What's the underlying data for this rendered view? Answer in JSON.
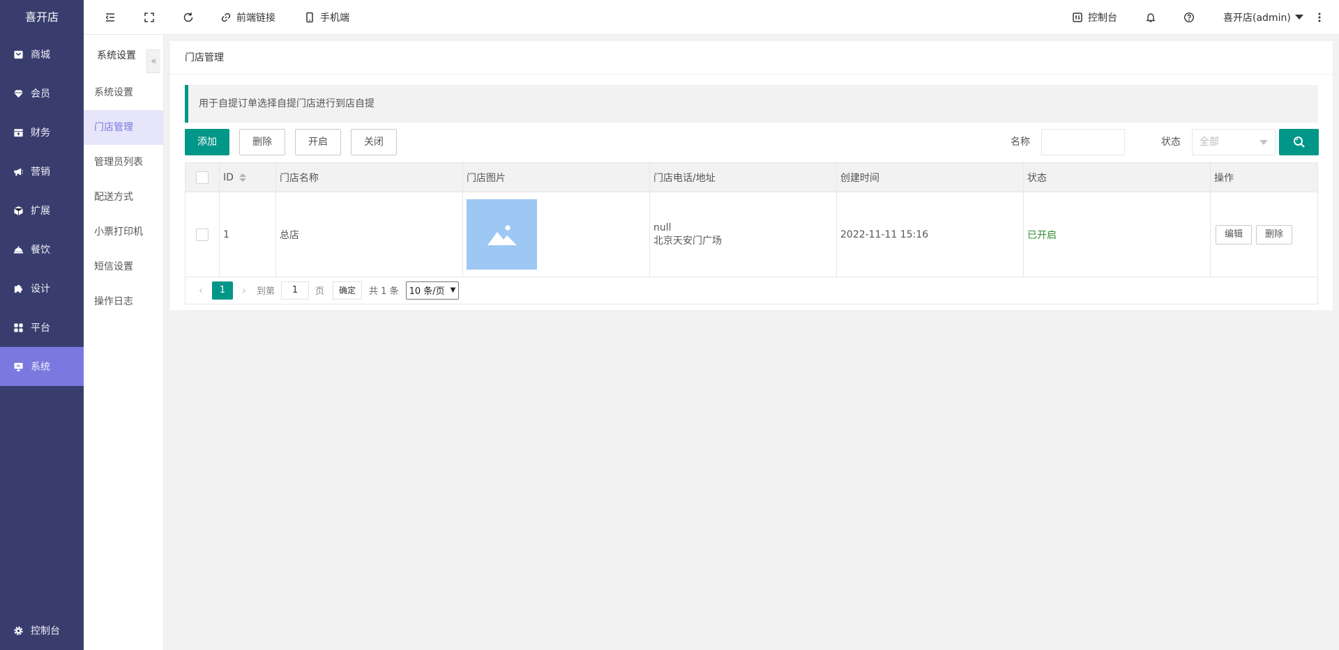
{
  "brand": "喜开店",
  "sidebar": {
    "items": [
      {
        "label": "商城",
        "icon": "shop-icon"
      },
      {
        "label": "会员",
        "icon": "diamond-icon"
      },
      {
        "label": "财务",
        "icon": "finance-icon"
      },
      {
        "label": "营销",
        "icon": "megaphone-icon"
      },
      {
        "label": "扩展",
        "icon": "cube-icon"
      },
      {
        "label": "餐饮",
        "icon": "catering-icon"
      },
      {
        "label": "设计",
        "icon": "puzzle-icon"
      },
      {
        "label": "平台",
        "icon": "grid-icon"
      },
      {
        "label": "系统",
        "icon": "monitor-icon",
        "active": true
      }
    ],
    "bottom": {
      "label": "控制台",
      "icon": "gear-icon"
    }
  },
  "subnav": {
    "title": "系统设置",
    "collapse": "«",
    "items": [
      "系统设置",
      "门店管理",
      "管理员列表",
      "配送方式",
      "小票打印机",
      "短信设置",
      "操作日志"
    ],
    "active_index": 1
  },
  "topbar": {
    "frontend_link": "前端链接",
    "mobile": "手机端",
    "console": "控制台",
    "user": "喜开店(admin)"
  },
  "page": {
    "title": "门店管理",
    "notice": "用于自提订单选择自提门店进行到店自提"
  },
  "toolbar": {
    "add": "添加",
    "delete": "删除",
    "open": "开启",
    "close": "关闭",
    "name_label": "名称",
    "name_value": "",
    "status_label": "状态",
    "status_value": "全部"
  },
  "table": {
    "columns": [
      "ID",
      "门店名称",
      "门店图片",
      "门店电话/地址",
      "创建时间",
      "状态",
      "操作"
    ],
    "rows": [
      {
        "id": "1",
        "name": "总店",
        "phone": "null",
        "address": "北京天安门广场",
        "created": "2022-11-11 15:16",
        "status": "已开启",
        "actions": {
          "edit": "编辑",
          "delete": "删除"
        }
      }
    ]
  },
  "pagination": {
    "current": "1",
    "goto_prefix": "到第",
    "goto_value": "1",
    "goto_suffix": "页",
    "confirm": "确定",
    "total": "共 1 条",
    "page_size": "10 条/页"
  },
  "colors": {
    "sidebar_bg": "#393d6e",
    "accent_purple": "#7b78e0",
    "primary_green": "#009688",
    "status_green": "#2e8b2e"
  }
}
